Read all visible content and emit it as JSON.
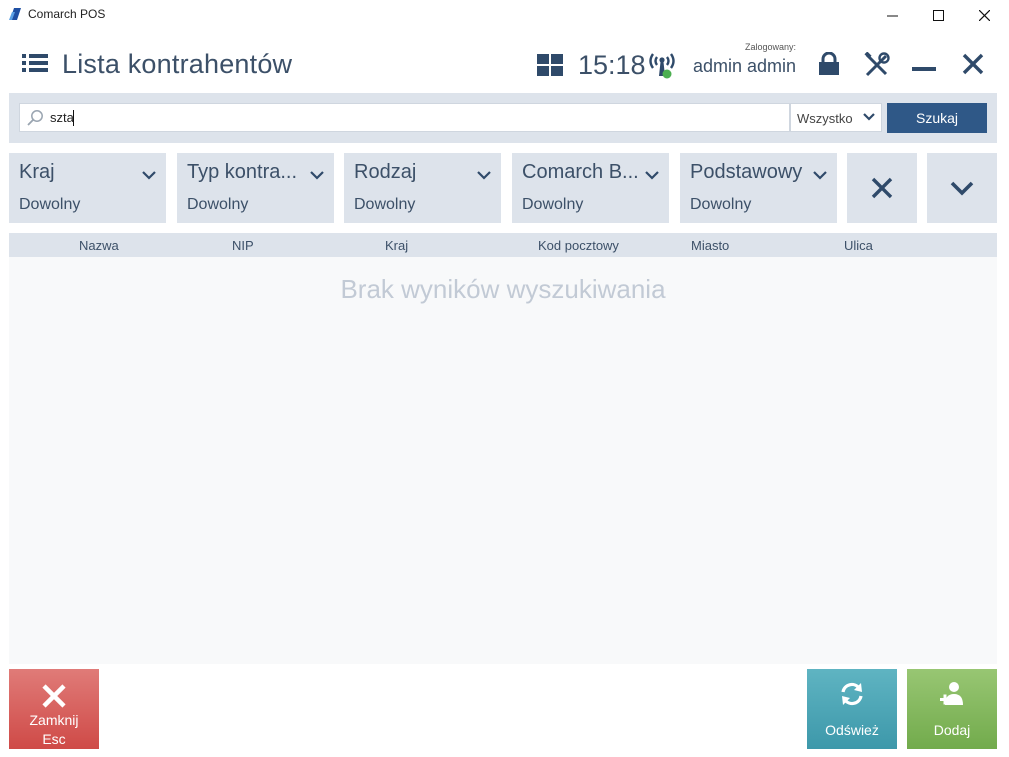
{
  "window": {
    "title": "Comarch POS",
    "controls": {
      "minimize": "—",
      "maximize": "☐",
      "close": "✕"
    }
  },
  "header": {
    "title": "Lista kontrahentów",
    "clock": "15:18",
    "logged_label": "Zalogowany:",
    "user_name": "admin admin",
    "connection_status_color": "#4caf50"
  },
  "search": {
    "value": "szta",
    "scope_value": "Wszystko",
    "button_label": "Szukaj"
  },
  "filters": [
    {
      "label": "Kraj",
      "value": "Dowolny"
    },
    {
      "label": "Typ kontra...",
      "value": "Dowolny"
    },
    {
      "label": "Rodzaj",
      "value": "Dowolny"
    },
    {
      "label": "Comarch B...",
      "value": "Dowolny"
    },
    {
      "label": "Podstawowy",
      "value": "Dowolny"
    }
  ],
  "table": {
    "columns": [
      "Nazwa",
      "NIP",
      "Kraj",
      "Kod pocztowy",
      "Miasto",
      "Ulica"
    ],
    "rows": [],
    "empty_message": "Brak wyników wyszukiwania"
  },
  "footer": {
    "close_label": "Zamknij",
    "close_shortcut": "Esc",
    "refresh_label": "Odśwież",
    "add_label": "Dodaj"
  },
  "colors": {
    "accent": "#2f5887",
    "panel": "#dde3eb",
    "close": "#d9534f",
    "refresh": "#3f9fb0",
    "add": "#7fb55a"
  }
}
